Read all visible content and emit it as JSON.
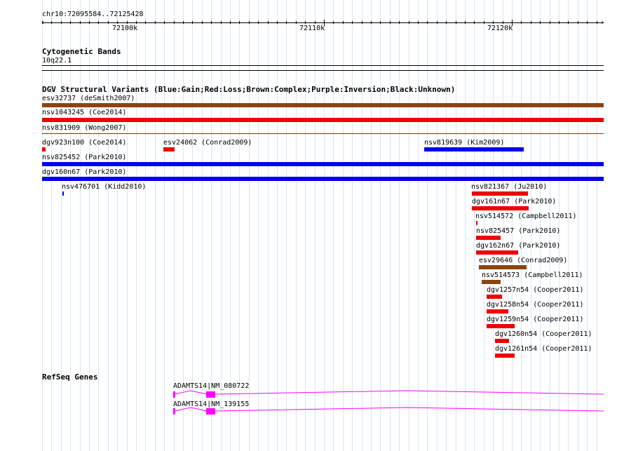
{
  "ruler": {
    "location": "chr10:72095584..72125428",
    "tick_labels": [
      "72100k",
      "72110k",
      "72120k"
    ]
  },
  "cytoband": {
    "title": "Cytogenetic Bands",
    "band": "10q22.1"
  },
  "dgv": {
    "title": "DGV Structural Variants (Blue:Gain;Red:Loss;Brown:Complex;Purple:Inversion;Black:Unknown)",
    "legend_colors": {
      "gain": "#0000ee",
      "loss": "#ee0000",
      "complex": "#8b4513",
      "inversion": "#800080",
      "unknown": "#000000"
    },
    "features": [
      {
        "label": "esv32737 (deSmith2007)",
        "type": "complex"
      },
      {
        "label": "nsv1043245 (Coe2014)",
        "type": "loss"
      },
      {
        "label": "nsv831909 (Wong2007)",
        "type": "loss"
      },
      {
        "label": "dgv923n100 (Coe2014)",
        "type": "loss"
      },
      {
        "label": "esv24062 (Conrad2009)",
        "type": "loss"
      },
      {
        "label": "nsv819639 (Kim2009)",
        "type": "gain"
      },
      {
        "label": "nsv825452 (Park2010)",
        "type": "gain"
      },
      {
        "label": "dgv160n67 (Park2010)",
        "type": "gain"
      },
      {
        "label": "nsv476701 (Kidd2010)",
        "type": "gain"
      },
      {
        "label": "nsv821367 (Ju2010)",
        "type": "loss"
      },
      {
        "label": "dgv161n67 (Park2010)",
        "type": "loss"
      },
      {
        "label": "nsv514572 (Campbell2011)",
        "type": "loss"
      },
      {
        "label": "nsv825457 (Park2010)",
        "type": "loss"
      },
      {
        "label": "dgv162n67 (Park2010)",
        "type": "loss"
      },
      {
        "label": "esv29646 (Conrad2009)",
        "type": "complex"
      },
      {
        "label": "nsv514573 (Campbell2011)",
        "type": "complex"
      },
      {
        "label": "dgv1257n54 (Cooper2011)",
        "type": "loss"
      },
      {
        "label": "dgv1258n54 (Cooper2011)",
        "type": "loss"
      },
      {
        "label": "dgv1259n54 (Cooper2011)",
        "type": "loss"
      },
      {
        "label": "dgv1260n54 (Cooper2011)",
        "type": "loss"
      },
      {
        "label": "dgv1261n54 (Cooper2011)",
        "type": "loss"
      }
    ]
  },
  "refseq": {
    "title": "RefSeq Genes",
    "gene_color": "#ff00ff",
    "genes": [
      {
        "label": "ADAMTS14|NM_080722"
      },
      {
        "label": "ADAMTS14|NM_139155"
      }
    ]
  }
}
